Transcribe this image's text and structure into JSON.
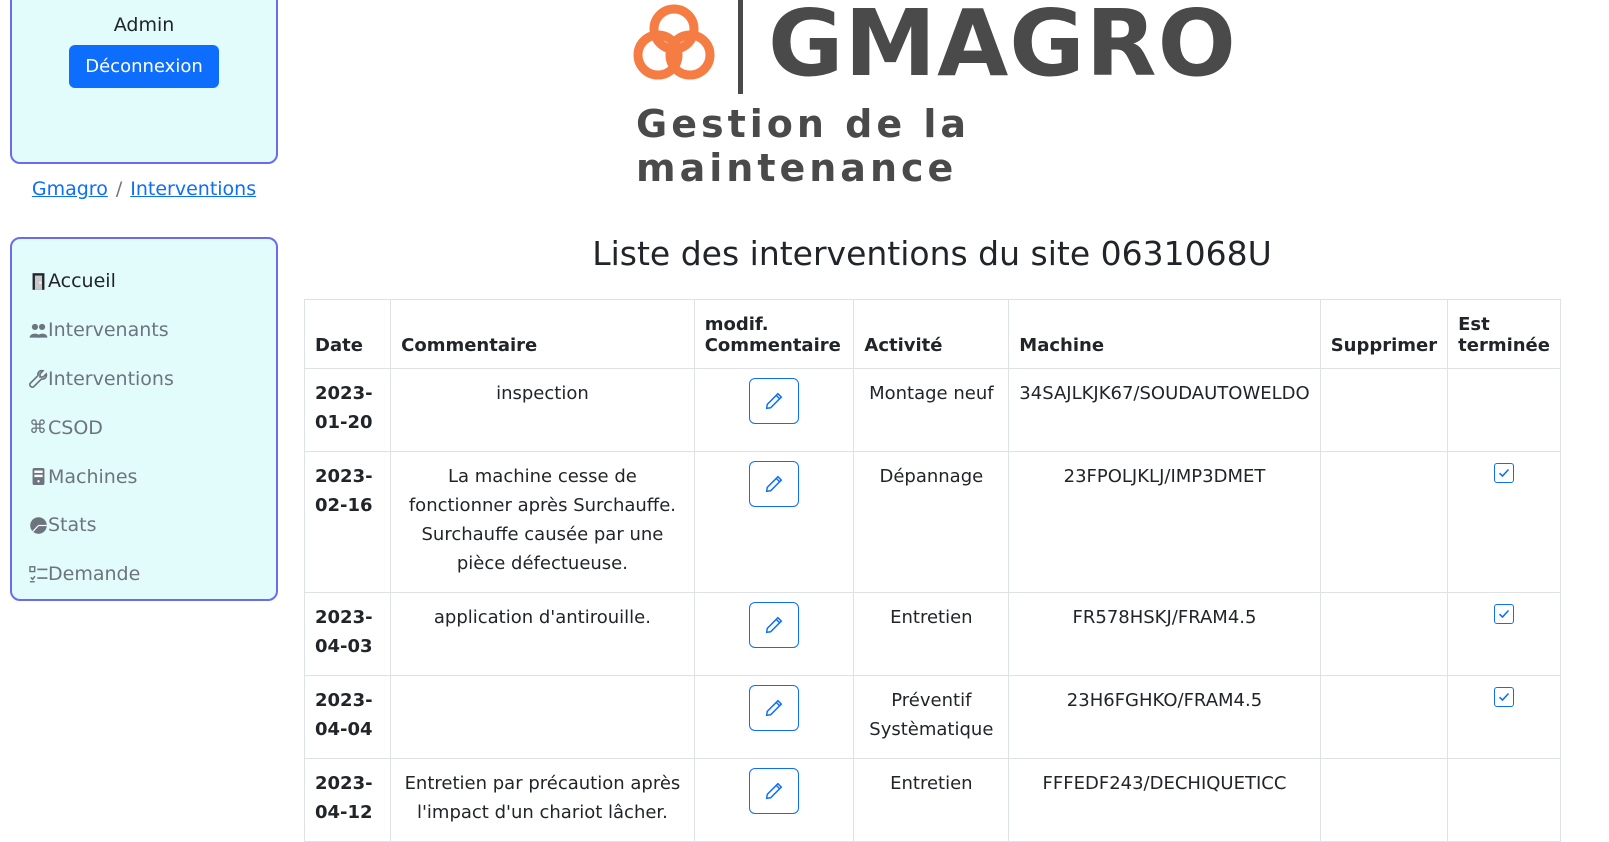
{
  "user": {
    "name": "Admin",
    "logout_label": "Déconnexion"
  },
  "breadcrumb": {
    "items": [
      "Gmagro",
      "Interventions"
    ],
    "separator": "/"
  },
  "nav": {
    "items": [
      {
        "label": "Accueil",
        "icon": "door-icon"
      },
      {
        "label": "Intervenants",
        "icon": "people-icon"
      },
      {
        "label": "Interventions",
        "icon": "wrench-icon"
      },
      {
        "label": "CSOD",
        "icon": "command-icon"
      },
      {
        "label": "Machines",
        "icon": "server-icon"
      },
      {
        "label": "Stats",
        "icon": "pie-chart-icon"
      },
      {
        "label": "Demande",
        "icon": "checklist-icon"
      }
    ]
  },
  "logo": {
    "name": "GMAGRO",
    "tagline": "Gestion de la maintenance"
  },
  "page": {
    "title": "Liste des interventions du site 0631068U"
  },
  "table": {
    "headers": [
      "Date",
      "Commentaire",
      "modif. Commentaire",
      "Activité",
      "Machine",
      "Supprimer",
      "Est terminée"
    ],
    "rows": [
      {
        "date": "2023-01-20",
        "commentaire": "inspection",
        "activite": "Montage neuf",
        "machine": "34SAJLKJK67/SOUDAUTOWELDO",
        "terminee": false
      },
      {
        "date": "2023-02-16",
        "commentaire": "La machine cesse de fonctionner après Surchauffe. Surchauffe causée par une pièce défectueuse.",
        "activite": "Dépannage",
        "machine": "23FPOLJKLJ/IMP3DMET",
        "terminee": true
      },
      {
        "date": "2023-04-03",
        "commentaire": "application d'antirouille.",
        "activite": "Entretien",
        "machine": "FR578HSKJ/FRAM4.5",
        "terminee": true
      },
      {
        "date": "2023-04-04",
        "commentaire": "",
        "activite": "Préventif Systèmatique",
        "machine": "23H6FGHKO/FRAM4.5",
        "terminee": true
      },
      {
        "date": "2023-04-12",
        "commentaire": "Entretien par précaution après l'impact d'un chariot lâcher.",
        "activite": "Entretien",
        "machine": "FFFEDF243/DECHIQUETICC",
        "terminee": false
      }
    ]
  },
  "colors": {
    "accent": "#0d6efd",
    "panel_bg": "#e2fbfb",
    "panel_border": "#6b6bf0",
    "logo_orange": "#f57c42",
    "logo_grey": "#4a4a4a"
  }
}
